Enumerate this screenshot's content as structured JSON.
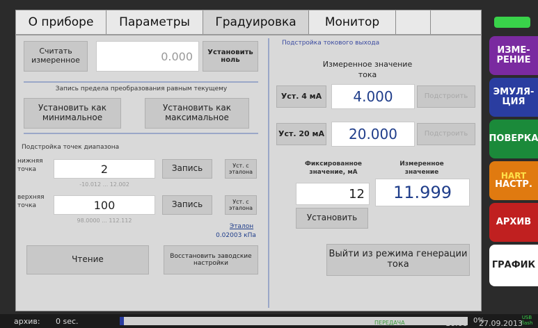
{
  "tabs": [
    "О приборе",
    "Параметры",
    "Градуировка",
    "Монитор"
  ],
  "left": {
    "read_measured_btn": "Считать измеренное",
    "measured_value": "0.000",
    "set_zero_btn": "Установить ноль",
    "limit_note": "Запись предела преобразования равным текущему",
    "set_min_btn": "Установить как минимальное",
    "set_max_btn": "Установить как максимальное",
    "range_title": "Подстройка точек диапазона",
    "low_point_label": "нижняя точка",
    "low_point_value": "2",
    "low_point_range": "-10.012 ... 12.002",
    "low_write_btn": "Запись",
    "low_ref_btn": "Уст. с эталона",
    "high_point_label": "верхняя точка",
    "high_point_value": "100",
    "high_point_range": "98.0000 ... 112.112",
    "high_write_btn": "Запись",
    "high_ref_btn": "Уст. с эталона",
    "etalon_label": "Эталон",
    "etalon_value": "0.02003 кПа",
    "read_btn": "Чтение",
    "restore_btn": "Восстановить заводские настройки"
  },
  "right": {
    "title": "Подстройка токового выхода",
    "measured_current_title": "Измеренное значение тока",
    "set4_label": "Уст. 4 мА",
    "set4_value": "4.000",
    "adjust4_btn": "Подстроить",
    "set20_label": "Уст. 20 мА",
    "set20_value": "20.000",
    "adjust20_btn": "Подстроить",
    "fixed_title": "Фиксированное значение, мА",
    "fixed_value": "12",
    "measured_title": "Измеренное значение",
    "measured_value": "11.999",
    "set_btn": "Установить",
    "exit_btn": "Выйти из режима генерации тока"
  },
  "side_menu": [
    {
      "label": "ИЗМЕ-РЕНИЕ",
      "color": "#7a2aa0"
    },
    {
      "label": "ЭМУЛЯ-ЦИЯ",
      "color": "#2a3da0"
    },
    {
      "label": "ПОВЕРКА",
      "color": "#1b8a3a"
    },
    {
      "label": "НАСТР.",
      "color": "#e07a10"
    },
    {
      "label": "АРХИВ",
      "color": "#c02020"
    },
    {
      "label": "ГРАФИК",
      "color": "#ffffff"
    }
  ],
  "side_hart": "HART",
  "status": {
    "archive_label": "архив:",
    "archive_time": "0 sec.",
    "progress_percent": "0%",
    "usb_label": "USB flash",
    "status_text": "ПЕРЕДАЧА",
    "time": "16:08",
    "date": "27.09.2013",
    "progress_fraction": 0.0
  },
  "colors": {
    "accent_blue": "#1f3d8a",
    "battery": "#39d24a"
  }
}
